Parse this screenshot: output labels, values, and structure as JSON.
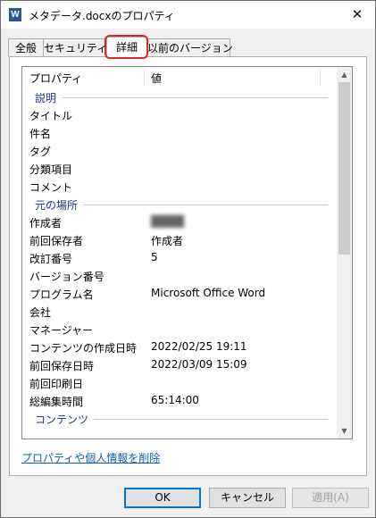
{
  "window": {
    "title": "メタデータ.docxのプロパティ",
    "app_icon_letter": "W",
    "close_glyph": "✕"
  },
  "tabs": [
    {
      "label": "全般",
      "active": false
    },
    {
      "label": "セキュリティ",
      "active": false
    },
    {
      "label": "詳細",
      "active": true
    },
    {
      "label": "以前のバージョン",
      "active": false
    }
  ],
  "list": {
    "columns": {
      "property": "プロパティ",
      "value": "値"
    },
    "groups": {
      "description": "説明",
      "origin": "元の場所",
      "content": "コンテンツ"
    },
    "description_rows": [
      {
        "name": "タイトル",
        "value": ""
      },
      {
        "name": "件名",
        "value": ""
      },
      {
        "name": "タグ",
        "value": ""
      },
      {
        "name": "分類項目",
        "value": ""
      },
      {
        "name": "コメント",
        "value": ""
      }
    ],
    "origin_rows": [
      {
        "name": "作成者",
        "value": "████"
      },
      {
        "name": "前回保存者",
        "value": "作成者"
      },
      {
        "name": "改訂番号",
        "value": "5"
      },
      {
        "name": "バージョン番号",
        "value": ""
      },
      {
        "name": "プログラム名",
        "value": "Microsoft Office Word"
      },
      {
        "name": "会社",
        "value": ""
      },
      {
        "name": "マネージャー",
        "value": ""
      },
      {
        "name": "コンテンツの作成日時",
        "value": "2022/02/25 19:11"
      },
      {
        "name": "前回保存日時",
        "value": "2022/03/09 15:09"
      },
      {
        "name": "前回印刷日",
        "value": ""
      },
      {
        "name": "総編集時間",
        "value": "65:14:00"
      }
    ],
    "scroll": {
      "up_glyph": "▲",
      "down_glyph": "▼"
    }
  },
  "remove_link": "プロパティや個人情報を削除",
  "buttons": {
    "ok": "OK",
    "cancel": "キャンセル",
    "apply": "適用(A)"
  },
  "accent_colors": {
    "highlight": "#e0242b",
    "group_text": "#1e3287",
    "link": "#0b5fb9",
    "focus": "#0078d7"
  }
}
